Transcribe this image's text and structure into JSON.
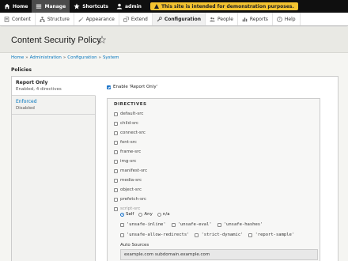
{
  "toolbar": {
    "home": "Home",
    "manage": "Manage",
    "shortcuts": "Shortcuts",
    "user": "admin",
    "demo_notice": "This site is intended for demonstration purposes."
  },
  "tray": {
    "items": [
      {
        "label": "Content",
        "icon": "content-icon"
      },
      {
        "label": "Structure",
        "icon": "structure-icon"
      },
      {
        "label": "Appearance",
        "icon": "appearance-icon"
      },
      {
        "label": "Extend",
        "icon": "extend-icon"
      },
      {
        "label": "Configuration",
        "icon": "configuration-icon"
      },
      {
        "label": "People",
        "icon": "people-icon"
      },
      {
        "label": "Reports",
        "icon": "reports-icon"
      },
      {
        "label": "Help",
        "icon": "help-icon"
      }
    ]
  },
  "page": {
    "title": "Content Security Policy",
    "breadcrumb": [
      "Home",
      "Administration",
      "Configuration",
      "System"
    ],
    "section_label": "Policies"
  },
  "tabs": [
    {
      "title": "Report Only",
      "summary": "Enabled, 4 directives"
    },
    {
      "title": "Enforced",
      "summary": "Disabled"
    }
  ],
  "pane": {
    "enable_label": "Enable 'Report Only'",
    "directives_legend": "DIRECTIVES",
    "directives": [
      "default-src",
      "child-src",
      "connect-src",
      "font-src",
      "frame-src",
      "img-src",
      "manifest-src",
      "media-src",
      "object-src",
      "prefetch-src",
      "script-src"
    ],
    "script_src_options": [
      "Self",
      "Any",
      "n/a"
    ],
    "keywords_row1": [
      "'unsafe-inline'",
      "'unsafe-eval'",
      "'unsafe-hashes'"
    ],
    "keywords_row2": [
      "'unsafe-allow-redirects'",
      "'strict-dynamic'",
      "'report-sample'"
    ],
    "auto_sources_label": "Auto Sources",
    "auto_sources_value": "example.com subdomain.example.com"
  },
  "colors": {
    "toolbar_bg": "#0f0f0f",
    "demo_badge": "#f4c430",
    "link": "#0074bd",
    "checkbox_accent": "#1a73c8"
  }
}
